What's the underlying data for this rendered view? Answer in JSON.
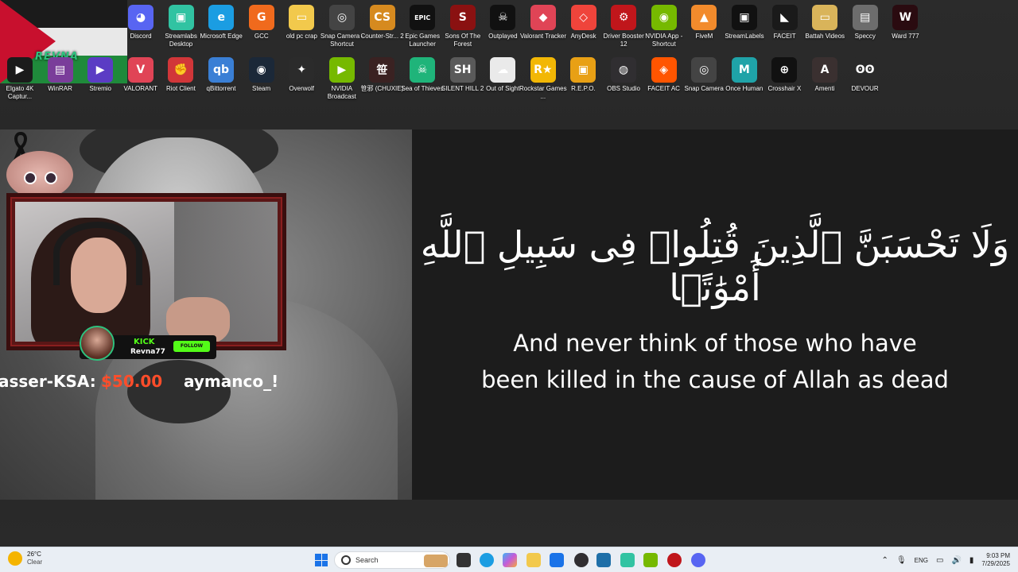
{
  "desktop": {
    "flag_brand": "REVNA",
    "icons_row1": [
      {
        "label": "Discord",
        "color": "#5865f2",
        "glyph": "◕"
      },
      {
        "label": "Streamlabs Desktop",
        "color": "#31c3a2",
        "glyph": "▣"
      },
      {
        "label": "Microsoft Edge",
        "color": "#1b9de2",
        "glyph": "e"
      },
      {
        "label": "GCC",
        "color": "#f06a1d",
        "glyph": "G"
      },
      {
        "label": "old pc crap",
        "color": "#f2c94c",
        "glyph": "▭"
      },
      {
        "label": "Snap Camera - Shortcut",
        "color": "#444",
        "glyph": "◎"
      },
      {
        "label": "Counter-Str... 2",
        "color": "#d68a1f",
        "glyph": "CS"
      },
      {
        "label": "Epic Games Launcher",
        "color": "#111",
        "glyph": "EPIC"
      },
      {
        "label": "Sons Of The Forest",
        "color": "#8a1111",
        "glyph": "S"
      },
      {
        "label": "Outplayed",
        "color": "#111",
        "glyph": "☠"
      },
      {
        "label": "Valorant Tracker",
        "color": "#e04456",
        "glyph": "◆"
      },
      {
        "label": "AnyDesk",
        "color": "#ef443b",
        "glyph": "◇"
      },
      {
        "label": "Driver Booster 12",
        "color": "#c0161b",
        "glyph": "⚙"
      },
      {
        "label": "NVIDIA App - Shortcut",
        "color": "#76b900",
        "glyph": "◉"
      },
      {
        "label": "FiveM",
        "color": "#f28b2c",
        "glyph": "▲"
      },
      {
        "label": "StreamLabels",
        "color": "#111",
        "glyph": "▣"
      },
      {
        "label": "FACEIT",
        "color": "#1a1a1a",
        "glyph": "◣"
      },
      {
        "label": "Battah Videos",
        "color": "#d9b45a",
        "glyph": "▭"
      },
      {
        "label": "Speccy",
        "color": "#6d6d6d",
        "glyph": "▤"
      },
      {
        "label": "Ward 777",
        "color": "#2a0b10",
        "glyph": "W"
      }
    ],
    "icons_row2": [
      {
        "label": "Elgato 4K Captur...",
        "color": "#1b1b1b",
        "glyph": "▶"
      },
      {
        "label": "WinRAR",
        "color": "#7a3d9a",
        "glyph": "▤"
      },
      {
        "label": "Stremio",
        "color": "#5b3cc4",
        "glyph": "▶"
      },
      {
        "label": "VALORANT",
        "color": "#e04456",
        "glyph": "V"
      },
      {
        "label": "Riot Client",
        "color": "#d13639",
        "glyph": "✊"
      },
      {
        "label": "qBittorrent",
        "color": "#3a7fd5",
        "glyph": "qb"
      },
      {
        "label": "Steam",
        "color": "#1b2838",
        "glyph": "◉"
      },
      {
        "label": "Overwolf",
        "color": "#2b2b2b",
        "glyph": "✦"
      },
      {
        "label": "NVIDIA Broadcast",
        "color": "#76b900",
        "glyph": "▶"
      },
      {
        "label": "笹邪 (CHUXIE)",
        "color": "#3a2222",
        "glyph": "笹"
      },
      {
        "label": "Sea of Thieves",
        "color": "#1fb47a",
        "glyph": "☠"
      },
      {
        "label": "SILENT HILL 2",
        "color": "#5a5a5a",
        "glyph": "SH"
      },
      {
        "label": "Out of Sight",
        "color": "#eaeaea",
        "glyph": "☁"
      },
      {
        "label": "Rockstar Games ...",
        "color": "#f2b705",
        "glyph": "R★"
      },
      {
        "label": "R.E.P.O.",
        "color": "#e8a015",
        "glyph": "▣"
      },
      {
        "label": "OBS Studio",
        "color": "#302e31",
        "glyph": "◍"
      },
      {
        "label": "FACEIT AC",
        "color": "#ff5500",
        "glyph": "◈"
      },
      {
        "label": "Snap Camera",
        "color": "#444",
        "glyph": "◎"
      },
      {
        "label": "Once Human",
        "color": "#1fa3a8",
        "glyph": "M"
      },
      {
        "label": "Crosshair X",
        "color": "#111",
        "glyph": "⊕"
      },
      {
        "label": "Amenti",
        "color": "#3a3030",
        "glyph": "A"
      },
      {
        "label": "DEVOUR",
        "color": "#2a2a2a",
        "glyph": "ʘʘ"
      }
    ]
  },
  "stream": {
    "kick_label": "KICK",
    "username": "Revna77",
    "follow_label": "FOLLOW",
    "ticker_name1": "asser-KSA:",
    "ticker_amount": "$50.00",
    "ticker_name2": "aymanco_!"
  },
  "quran": {
    "arabic": "وَلَا تَحْسَبَنَّ ٱلَّذِينَ قُتِلُوا۟ فِى سَبِيلِ ٱللَّهِ أَمْوَٰتًۢا",
    "translation_line1": "And never think of those who have",
    "translation_line2": "been killed in the cause of Allah as dead"
  },
  "taskbar": {
    "weather_temp": "26°C",
    "weather_cond": "Clear",
    "search_placeholder": "Search",
    "lang": "ENG",
    "time": "9:03 PM",
    "date": "7/29/2025"
  }
}
